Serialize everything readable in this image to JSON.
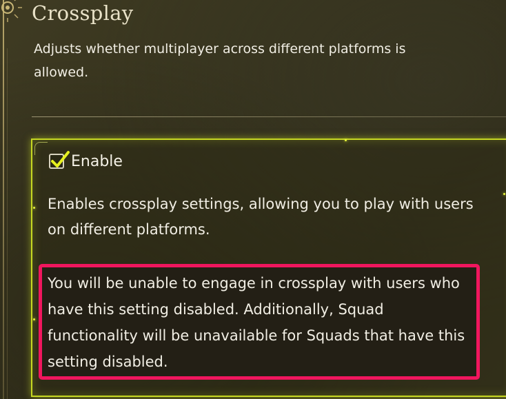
{
  "setting": {
    "title": "Crossplay",
    "description": "Adjusts whether multiplayer across different platforms is allowed."
  },
  "enable_option": {
    "label": "Enable",
    "checked": true,
    "description": "Enables crossplay settings, allowing you to play with users on different platforms.",
    "note": "You will be unable to engage in crossplay with users who have this setting disabled. Additionally, Squad functionality will be unavailable for Squads that have this setting disabled."
  },
  "colors": {
    "highlight_border": "#f0165e",
    "panel_glow": "#c6d822",
    "checkmark": "#e6f020"
  }
}
